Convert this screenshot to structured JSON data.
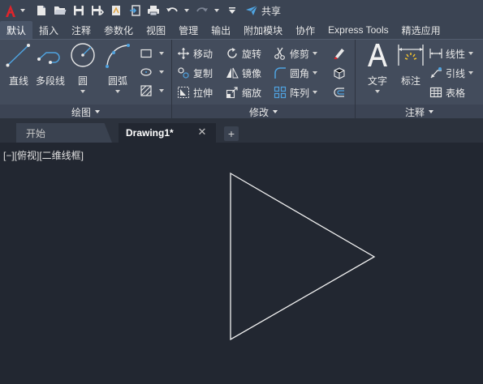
{
  "quick_access": {
    "app_icon": "autocad-a-logo",
    "icons": [
      "new-file-icon",
      "open-folder-icon",
      "save-icon",
      "save-as-icon",
      "plot-preview-icon",
      "import-icon",
      "print-icon",
      "undo-icon",
      "redo-icon"
    ],
    "share_label": "共享"
  },
  "ribbon_tabs": [
    "默认",
    "插入",
    "注释",
    "参数化",
    "视图",
    "管理",
    "输出",
    "附加模块",
    "协作",
    "Express Tools",
    "精选应用"
  ],
  "active_tab": "默认",
  "panels": {
    "draw": {
      "title": "绘图",
      "line": "直线",
      "polyline": "多段线",
      "circle": "圆",
      "arc": "圆弧"
    },
    "modify": {
      "title": "修改",
      "move": "移动",
      "rotate": "旋转",
      "trim": "修剪",
      "copy": "复制",
      "mirror": "镜像",
      "fillet": "圆角",
      "stretch": "拉伸",
      "scale": "缩放",
      "array": "阵列"
    },
    "annotation": {
      "title": "注释",
      "text": "文字",
      "dimension": "标注",
      "linear": "线性",
      "leader": "引线",
      "table": "表格"
    }
  },
  "doc_tabs": {
    "start": "开始",
    "drawing": "Drawing1*",
    "close_symbol": "✕",
    "new_symbol": "+"
  },
  "viewport": {
    "label": "[−][俯视][二维线框]"
  },
  "colors": {
    "accent_red": "#e0242b",
    "icon_blue": "#4fa3e0",
    "background": "#222731"
  }
}
